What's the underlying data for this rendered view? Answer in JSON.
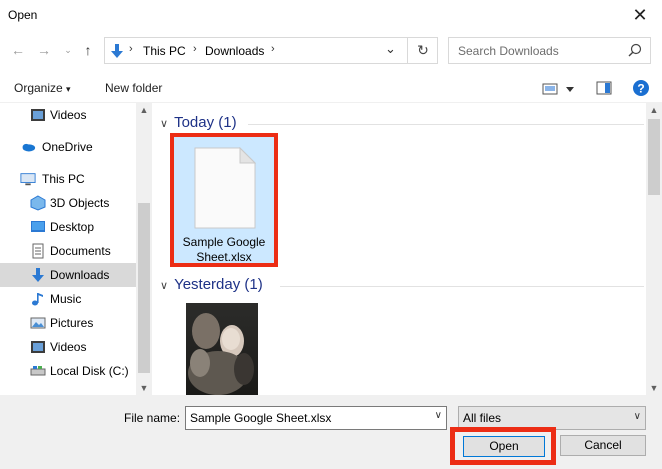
{
  "window": {
    "title": "Open"
  },
  "nav": {
    "breadcrumb": [
      "This PC",
      "Downloads"
    ],
    "search_placeholder": "Search Downloads"
  },
  "toolbar": {
    "organize": "Organize",
    "new_folder": "New folder"
  },
  "sidebar": {
    "items": [
      {
        "label": "Videos",
        "icon": "video-folder-icon"
      },
      {
        "label": "OneDrive",
        "icon": "cloud-icon"
      },
      {
        "label": "This PC",
        "icon": "computer-icon"
      },
      {
        "label": "3D Objects",
        "icon": "cube-folder-icon"
      },
      {
        "label": "Desktop",
        "icon": "desktop-folder-icon"
      },
      {
        "label": "Documents",
        "icon": "document-folder-icon"
      },
      {
        "label": "Downloads",
        "icon": "download-arrow-icon",
        "selected": true
      },
      {
        "label": "Music",
        "icon": "music-note-icon"
      },
      {
        "label": "Pictures",
        "icon": "picture-folder-icon"
      },
      {
        "label": "Videos",
        "icon": "video-folder-icon"
      },
      {
        "label": "Local Disk (C:)",
        "icon": "drive-icon"
      }
    ]
  },
  "content": {
    "groups": [
      {
        "label": "Today (1)",
        "files": [
          {
            "name_line1": "Sample Google",
            "name_line2": "Sheet.xlsx"
          }
        ]
      },
      {
        "label": "Yesterday (1)",
        "files": [
          {
            "name": "image thumbnail"
          }
        ]
      }
    ]
  },
  "footer": {
    "file_name_label": "File name:",
    "file_name_value": "Sample Google Sheet.xlsx",
    "file_type": "All files",
    "open": "Open",
    "cancel": "Cancel"
  },
  "colors": {
    "highlight": "#ec2d15",
    "selection": "#cce8ff",
    "group_header": "#1e3287"
  }
}
